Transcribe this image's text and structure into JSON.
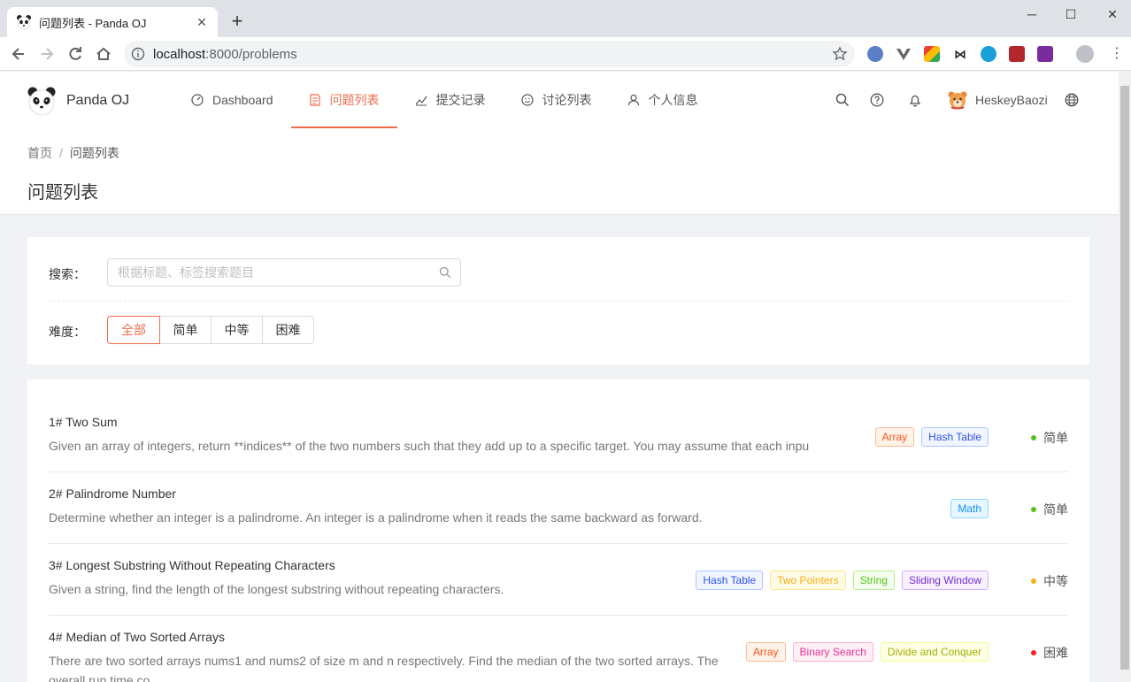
{
  "browser": {
    "tab_title": "问题列表 - Panda OJ",
    "url_host": "localhost",
    "url_rest": ":8000/problems"
  },
  "nav": {
    "brand": "Panda OJ",
    "items": [
      {
        "label": "Dashboard",
        "icon": "dashboard-icon"
      },
      {
        "label": "问题列表",
        "icon": "file-text-icon",
        "active": true
      },
      {
        "label": "提交记录",
        "icon": "line-chart-icon"
      },
      {
        "label": "讨论列表",
        "icon": "smile-icon"
      },
      {
        "label": "个人信息",
        "icon": "user-icon"
      }
    ],
    "username": "HeskeyBaozi"
  },
  "header": {
    "breadcrumb": [
      "首页",
      "问题列表"
    ],
    "title": "问题列表"
  },
  "filter": {
    "search_label": "搜索：",
    "search_placeholder": "根据标题、标签搜索题目",
    "difficulty_label": "难度：",
    "difficulty_options": [
      "全部",
      "简单",
      "中等",
      "困难"
    ],
    "selected": "全部"
  },
  "problems": [
    {
      "title": "1# Two Sum",
      "desc": "Given an array of integers, return **indices** of the two numbers such that they add up to a specific target. You may assume that each inpu",
      "tags": [
        "Array",
        "Hash Table"
      ],
      "difficulty": "简单"
    },
    {
      "title": "2# Palindrome Number",
      "desc": "Determine whether an integer is a palindrome. An integer is a palindrome when it reads the same backward as forward.",
      "tags": [
        "Math"
      ],
      "difficulty": "简单"
    },
    {
      "title": "3# Longest Substring Without Repeating Characters",
      "desc": "Given a string, find the length of the longest substring without repeating characters.",
      "tags": [
        "Hash Table",
        "Two Pointers",
        "String",
        "Sliding Window"
      ],
      "difficulty": "中等"
    },
    {
      "title": "4# Median of Two Sorted Arrays",
      "desc": "There are two sorted arrays nums1 and nums2 of size m and n respectively. Find the median of the two sorted arrays. The overall run time co",
      "tags": [
        "Array",
        "Binary Search",
        "Divide and Conquer"
      ],
      "difficulty": "困难"
    }
  ],
  "colors": {
    "accent": "#ee6c4d",
    "easy": "#52c41a",
    "medium": "#faad14",
    "hard": "#f5222d"
  }
}
